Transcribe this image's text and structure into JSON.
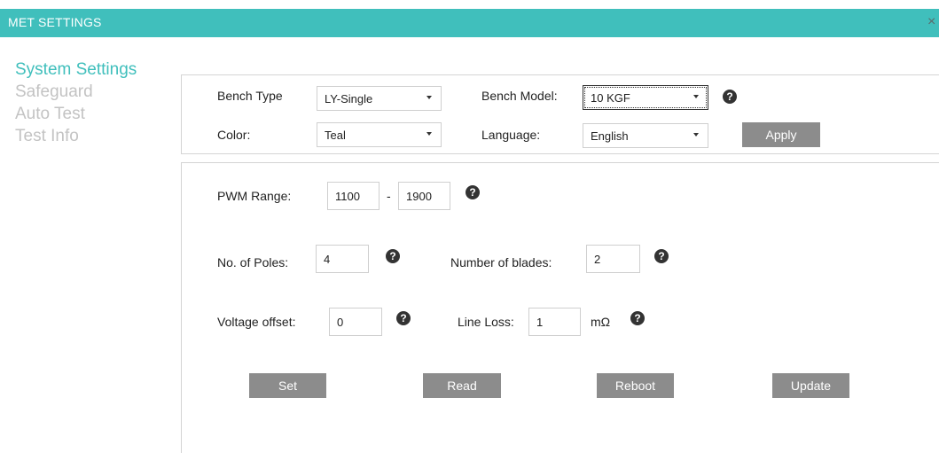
{
  "window": {
    "title": "MET SETTINGS",
    "close_label": "×"
  },
  "sidebar": {
    "items": [
      {
        "label": "System Settings",
        "active": true
      },
      {
        "label": "Safeguard",
        "active": false
      },
      {
        "label": "Auto Test",
        "active": false
      },
      {
        "label": "Test Info",
        "active": false
      }
    ]
  },
  "top_panel": {
    "bench_type_label": "Bench Type",
    "bench_type_value": "LY-Single",
    "bench_model_label": "Bench Model:",
    "bench_model_value": "10 KGF",
    "color_label": "Color:",
    "color_value": "Teal",
    "language_label": "Language:",
    "language_value": "English",
    "apply_label": "Apply"
  },
  "bottom_panel": {
    "pwm_range_label": "PWM Range:",
    "pwm_min": "1100",
    "pwm_separator": "-",
    "pwm_max": "1900",
    "poles_label": "No. of Poles:",
    "poles_value": "4",
    "blades_label": "Number of blades:",
    "blades_value": "2",
    "voltage_offset_label": "Voltage offset:",
    "voltage_offset_value": "0",
    "line_loss_label": "Line Loss:",
    "line_loss_value": "1",
    "line_loss_unit": "mΩ",
    "help_glyph": "?",
    "buttons": {
      "set": "Set",
      "read": "Read",
      "reboot": "Reboot",
      "update": "Update"
    }
  },
  "colors": {
    "accent": "#40bfbc",
    "button": "#8c8c8c",
    "inactive_nav": "#c3c3c3"
  }
}
